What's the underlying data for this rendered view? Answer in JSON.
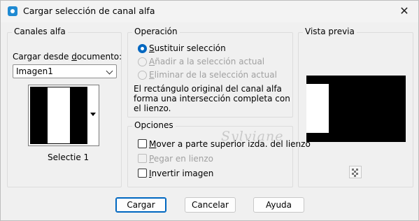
{
  "window": {
    "title": "Cargar selección de canal alfa",
    "close_glyph": "✕"
  },
  "channels": {
    "group_title": "Canales alfa",
    "load_label": "Cargar desde documento:",
    "load_label_prefix": "Cargar desde ",
    "load_label_accel": "d",
    "load_label_suffix": "ocumento:",
    "document_selected": "Imagen1",
    "channel_name": "Selectie 1"
  },
  "operation": {
    "group_title": "Operación",
    "options": [
      {
        "accel": "S",
        "rest": "ustituir selección",
        "checked": true,
        "disabled": false
      },
      {
        "accel": "A",
        "rest": "ñadir a la selección actual",
        "checked": false,
        "disabled": true
      },
      {
        "accel": "E",
        "rest": "liminar de la selección actual",
        "checked": false,
        "disabled": true
      }
    ],
    "description": [
      "El rectángulo original del canal alfa",
      "forma una intersección completa con",
      "el lienzo."
    ]
  },
  "options": {
    "group_title": "Opciones",
    "move_top_left": {
      "accel": "M",
      "rest": "over a parte superior izda. del lienzo",
      "checked": false,
      "disabled": false
    },
    "paste_canvas": {
      "accel": "P",
      "rest": "egar en lienzo",
      "checked": false,
      "disabled": true
    },
    "invert_image": {
      "accel": "I",
      "rest": "nvertir imagen",
      "checked": false,
      "disabled": false
    }
  },
  "preview": {
    "group_title": "Vista previa",
    "zoom_icon": "checker-zoom-icon"
  },
  "watermark": "Sylviane",
  "buttons": {
    "load": "Cargar",
    "cancel": "Cancelar",
    "help": "Ayuda"
  },
  "colors": {
    "accent": "#0067c0",
    "background": "#f0f0f0"
  }
}
